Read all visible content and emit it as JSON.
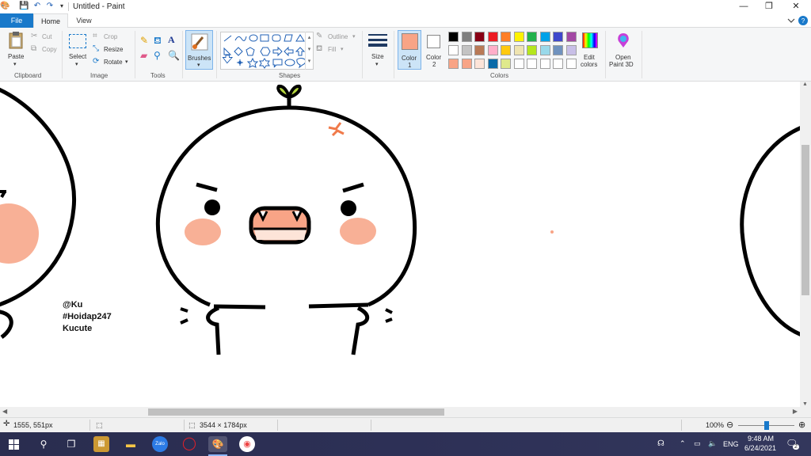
{
  "window": {
    "title": "Untitled - Paint",
    "minimize_label": "—",
    "maximize_label": "❐",
    "close_label": "✕"
  },
  "tabs": [
    {
      "label": "File"
    },
    {
      "label": "Home"
    },
    {
      "label": "View"
    }
  ],
  "ribbon": {
    "clipboard": {
      "paste": "Paste",
      "cut": "Cut",
      "copy": "Copy",
      "group": "Clipboard"
    },
    "image": {
      "select": "Select",
      "crop": "Crop",
      "resize": "Resize",
      "rotate": "Rotate",
      "group": "Image"
    },
    "tools": {
      "group": "Tools"
    },
    "brushes": {
      "label": "Brushes"
    },
    "shapes": {
      "outline": "Outline",
      "fill": "Fill",
      "group": "Shapes"
    },
    "size": {
      "label": "Size"
    },
    "color1": {
      "label": "Color",
      "num": "1",
      "color": "#f8a486"
    },
    "color2": {
      "label": "Color",
      "num": "2",
      "color": "#ffffff"
    },
    "colors": {
      "group": "Colors",
      "row1": [
        "#000000",
        "#7f7f7f",
        "#880015",
        "#ed1c24",
        "#ff7f27",
        "#fff200",
        "#22b14c",
        "#00a2e8",
        "#3f48cc",
        "#a349a4"
      ],
      "row2": [
        "#ffffff",
        "#c3c3c3",
        "#b97a57",
        "#ffaec9",
        "#ffc90e",
        "#efe4b0",
        "#b5e61d",
        "#99d9ea",
        "#7092be",
        "#c8bfe7"
      ],
      "row3": [
        "#f8a486",
        "#f8a486",
        "#fde4d8",
        "#0a6aa8",
        "#dfe98c",
        "#ffffff",
        "#ffffff",
        "#ffffff",
        "#ffffff",
        "#ffffff"
      ]
    },
    "edit_colors": {
      "line1": "Edit",
      "line2": "colors"
    },
    "paint3d": {
      "line1": "Open",
      "line2": "Paint 3D"
    }
  },
  "canvas": {
    "text_lines": [
      "@Ku",
      "#Hoidap247",
      "Kucute"
    ]
  },
  "status": {
    "cursor_pos": "1555, 551px",
    "image_size": "3544 × 1784px",
    "zoom": "100%",
    "zoom_percent": 100
  },
  "taskbar": {
    "time": "9:48 AM",
    "date": "6/24/2021",
    "language": "ENG",
    "notification_count": "2"
  }
}
